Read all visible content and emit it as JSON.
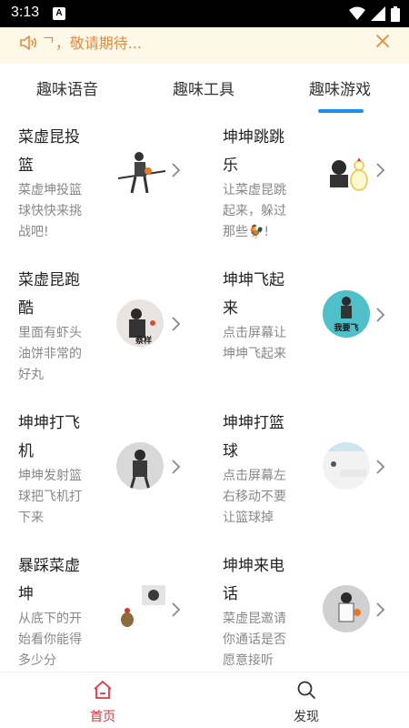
{
  "status_bar": {
    "time": "3:13",
    "notification_letter": "A"
  },
  "notice": {
    "text": "ᄀ，敬请期待...",
    "color": "#e88a3a"
  },
  "tabs": [
    {
      "label": "趣味语音"
    },
    {
      "label": "趣味工具"
    },
    {
      "label": "趣味游戏",
      "selected": true
    }
  ],
  "games": [
    {
      "title": "菜虚昆投篮",
      "description": "菜虚坤投篮球快快来挑战吧!"
    },
    {
      "title": "坤坤跳跳乐",
      "description": "让菜虚昆跳起来，躲过那些🐓!"
    },
    {
      "title": "菜虚昆跑酷",
      "description": "里面有虾头油饼非常的好丸",
      "thumb_text": "蔡样"
    },
    {
      "title": "坤坤飞起来",
      "description": "点击屏幕让坤坤飞起来",
      "thumb_text": "我要飞"
    },
    {
      "title": "坤坤打飞机",
      "description": "坤坤发射篮球把飞机打下来"
    },
    {
      "title": "坤坤打篮球",
      "description": "点击屏幕左右移动不要让篮球掉"
    },
    {
      "title": "暴踩菜虚坤",
      "description": "从底下的开始看你能得多少分"
    },
    {
      "title": "坤坤来电话",
      "description": "菜虚昆邀请你通话是否愿意接听"
    }
  ],
  "bottom_nav": [
    {
      "label": "首页",
      "active": true
    },
    {
      "label": "发现"
    }
  ],
  "colors": {
    "accent": "#e8323c",
    "tab_indicator": "#1a8ff0",
    "notice_bg": "#fef8e8"
  }
}
